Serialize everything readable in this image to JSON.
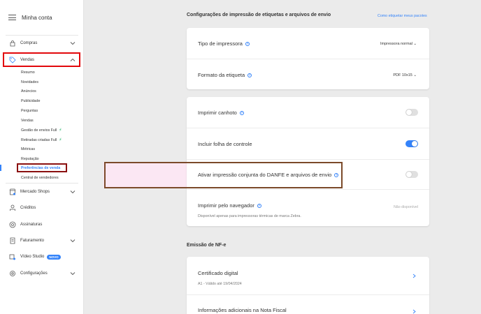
{
  "sidebar": {
    "title": "Minha conta",
    "compras": "Compras",
    "vendas": "Vendas",
    "vendas_items": [
      "Resumo",
      "Novidades",
      "Anúncios",
      "Publicidade",
      "Perguntas",
      "Vendas",
      "Gestão de envios Full",
      "Retiradas criadas Full",
      "Métricas",
      "Reputação",
      "Preferências de venda",
      "Central de vendedores"
    ],
    "mercado_shops": "Mercado Shops",
    "creditos": "Créditos",
    "assinaturas": "Assinaturas",
    "faturamento": "Faturamento",
    "video_studio": "Vídeo Studio",
    "novo_badge": "NOVO",
    "configuracoes": "Configurações"
  },
  "colors": {
    "accent": "#3483fa",
    "highlight_red": "#e2070b",
    "highlight_brown": "#7b4a2a",
    "bolt_green": "#00a650",
    "pink_band": "#fbe7f3"
  },
  "main": {
    "section1_title": "Configurações de impressão de etiquetas e arquivos de envio",
    "section1_link": "Como etiquetar meus pacotes",
    "tipo_impressora_label": "Tipo de impressora",
    "tipo_impressora_value": "Impressora normal",
    "formato_label": "Formato da etiqueta",
    "formato_value": "PDF 10x15",
    "canhoto_label": "Imprimir canhoto",
    "folha_label": "Incluir folha de controle",
    "danfe_label": "Ativar impressão conjunta do DANFE e arquivos de envio",
    "navegador_label": "Imprimir pelo navegador",
    "navegador_sub": "Disponível apenas para impressoras térmicas de marca Zebra.",
    "navegador_status": "Não disponível",
    "section2_title": "Emissão de NF-e",
    "certificado_label": "Certificado digital",
    "certificado_sub": "A1 - Válido até 19/04/2024",
    "info_label": "Informações adicionais na Nota Fiscal"
  }
}
